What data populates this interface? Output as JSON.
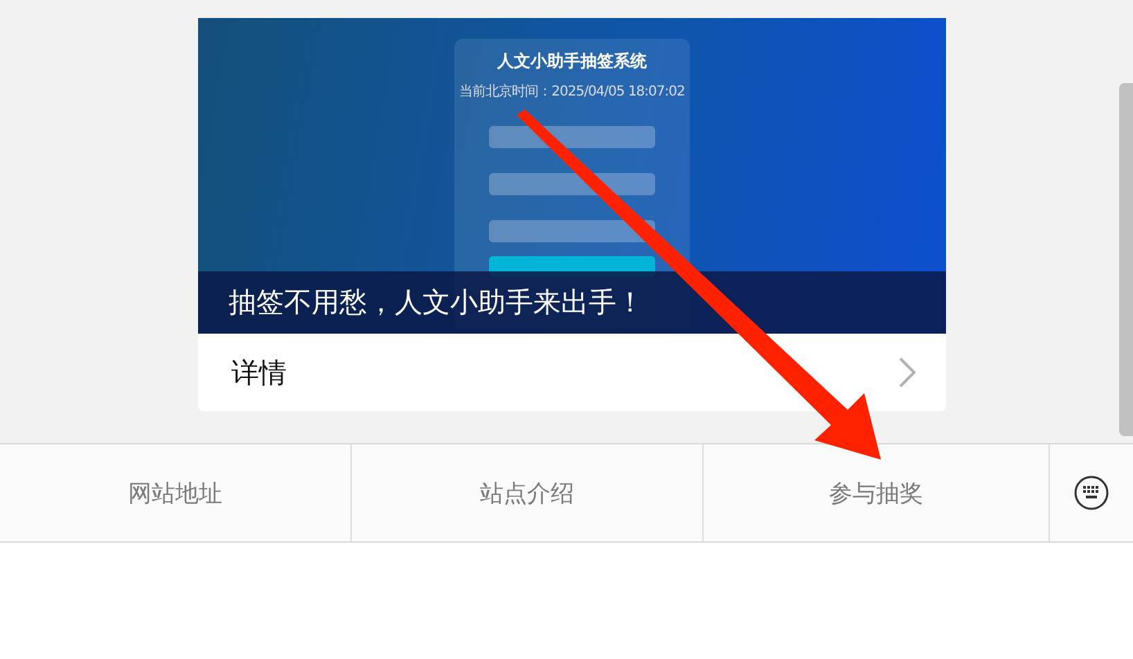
{
  "card": {
    "screenshot": {
      "title": "人文小助手抽签系统",
      "time": "当前北京时间：2025/04/05 18:07:02"
    },
    "caption": "抽签不用愁，人文小助手来出手！",
    "details": "详情"
  },
  "menu": [
    {
      "label": "网站地址"
    },
    {
      "label": "站点介绍"
    },
    {
      "label": "参与抽奖"
    }
  ]
}
